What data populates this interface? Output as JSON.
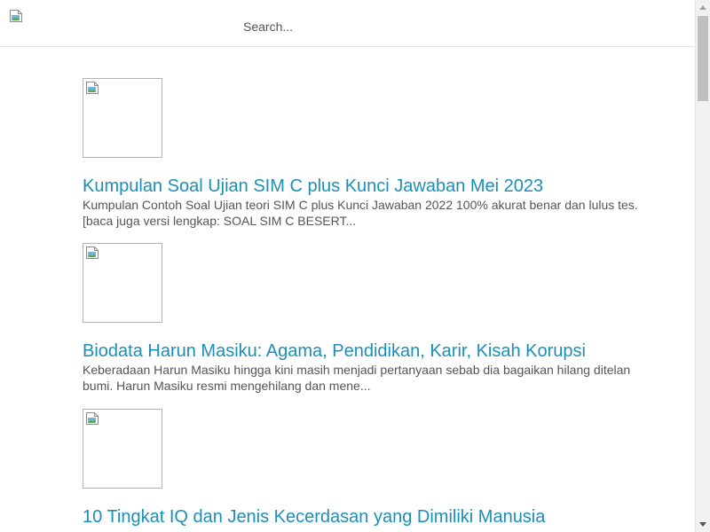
{
  "header": {
    "search_placeholder": "Search..."
  },
  "articles": [
    {
      "title": "Kumpulan Soal Ujian SIM C plus Kunci Jawaban Mei 2023",
      "excerpt": "Kumpulan Contoh Soal Ujian teori SIM C plus Kunci Jawaban 2022 100% akurat benar dan lulus tes. [baca juga versi lengkap:  SOAL SIM C BESERT..."
    },
    {
      "title": "Biodata Harun Masiku: Agama, Pendidikan, Karir, Kisah Korupsi",
      "excerpt": "Keberadaan Harun Masiku hingga kini masih menjadi pertanyaan sebab dia bagaikan hilang ditelan bumi. Harun Masiku resmi mengehilang dan mene..."
    },
    {
      "title": "10 Tingkat IQ dan Jenis Kecerdasan yang Dimiliki Manusia",
      "excerpt": ""
    }
  ],
  "colors": {
    "link": "#1c8fb9",
    "excerpt": "#555555",
    "border": "#e2e2e2"
  }
}
